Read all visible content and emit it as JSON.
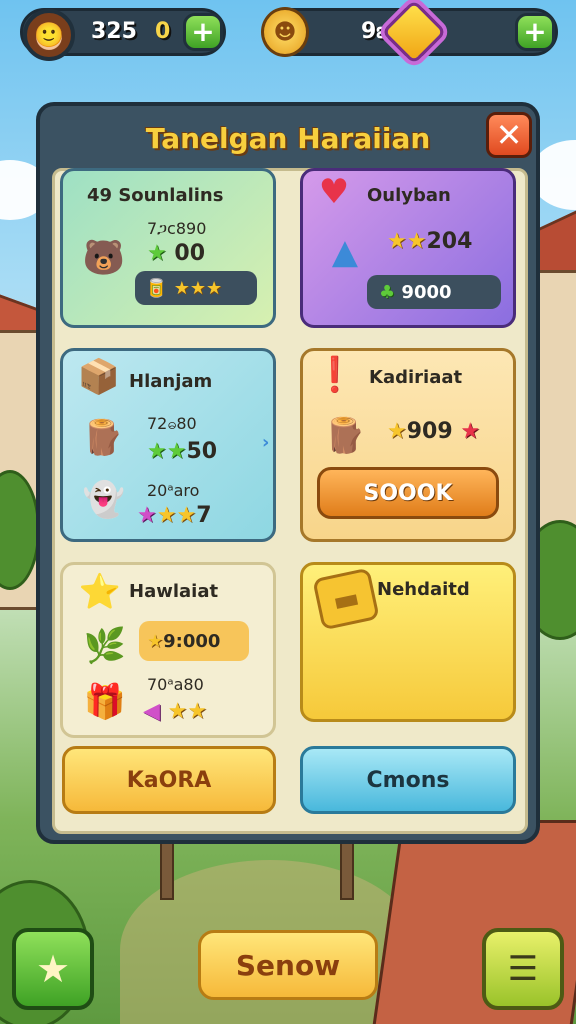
{
  "hud": {
    "player_count": "325",
    "player_zero": "0",
    "currency": "9ఽ",
    "plus_symbol": "+"
  },
  "panel": {
    "title": "Tanelgan Haraiian",
    "close_symbol": "✕"
  },
  "cards": [
    {
      "title": "49 Sounlalins",
      "line1": "7ጋc890",
      "line1_value": "00",
      "pill_value": ""
    },
    {
      "title": "Oulyban",
      "line1_value": "204",
      "pill_value": "9000"
    },
    {
      "title": "Hlanjam",
      "line1": "72ဓ80",
      "line1_value": "50",
      "line2": "20ᵃaro",
      "line2_value": "7"
    },
    {
      "title": "Kadiriaat",
      "line1_value": "909",
      "button": "SOOOK"
    },
    {
      "title": "Hawlaiat",
      "pill_value": "9:000",
      "line2": "70ᵃa80"
    },
    {
      "title": "Nehdaitd"
    }
  ],
  "panel_buttons": {
    "left": "KaORA",
    "right": "Cmons"
  },
  "bottom": {
    "center_button": "Senow"
  }
}
